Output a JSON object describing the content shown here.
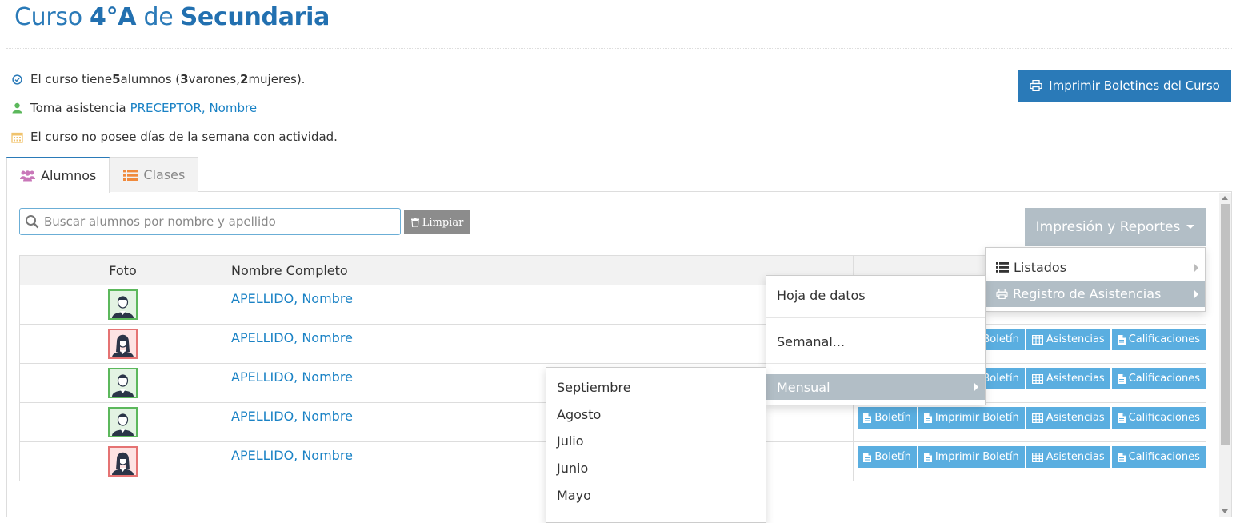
{
  "page": {
    "title_prefix": "Curso ",
    "title_grade": "4°A",
    "title_mid": " de ",
    "title_level": "Secundaria"
  },
  "info": {
    "line1_a": "El curso tiene ",
    "line1_count": "5",
    "line1_b": " alumnos (",
    "line1_male": "3",
    "line1_c": " varones, ",
    "line1_female": "2",
    "line1_d": " mujeres).",
    "line2_label": "Toma asistencia",
    "line2_link": "PRECEPTOR, Nombre",
    "line3": "El curso no posee días de la semana con actividad."
  },
  "print_button": "Imprimir Boletines del Curso",
  "tabs": [
    {
      "label": "Alumnos",
      "active": true
    },
    {
      "label": "Clases",
      "active": false
    }
  ],
  "search": {
    "placeholder": "Buscar alumnos por nombre y apellido",
    "clear_label": "Limpiar"
  },
  "reports_button": "Impresión y Reportes",
  "table": {
    "headers": [
      "Foto",
      "Nombre Completo",
      ""
    ],
    "rows": [
      {
        "name": "APELLIDO, Nombre",
        "gender": "m"
      },
      {
        "name": "APELLIDO, Nombre",
        "gender": "f"
      },
      {
        "name": "APELLIDO, Nombre",
        "gender": "m"
      },
      {
        "name": "APELLIDO, Nombre",
        "gender": "m"
      },
      {
        "name": "APELLIDO, Nombre",
        "gender": "f"
      }
    ],
    "actions": {
      "boletin": "Boletín",
      "imprimir": "Imprimir Boletín",
      "asistencias": "Asistencias",
      "calificaciones": "Calificaciones"
    }
  },
  "menu_reports": [
    {
      "label": "Listados",
      "icon": "list-icon"
    },
    {
      "label": "Registro de Asistencias",
      "icon": "print-icon"
    }
  ],
  "menu_attendance": [
    "Hoja de datos",
    "Semanal...",
    "Mensual"
  ],
  "menu_months": [
    "Septiembre",
    "Agosto",
    "Julio",
    "Junio",
    "Mayo"
  ],
  "colors": {
    "primary": "#2a7ab8",
    "link": "#1a82c5",
    "action": "#5aaee0",
    "menu_highlight": "#b2bec6"
  }
}
